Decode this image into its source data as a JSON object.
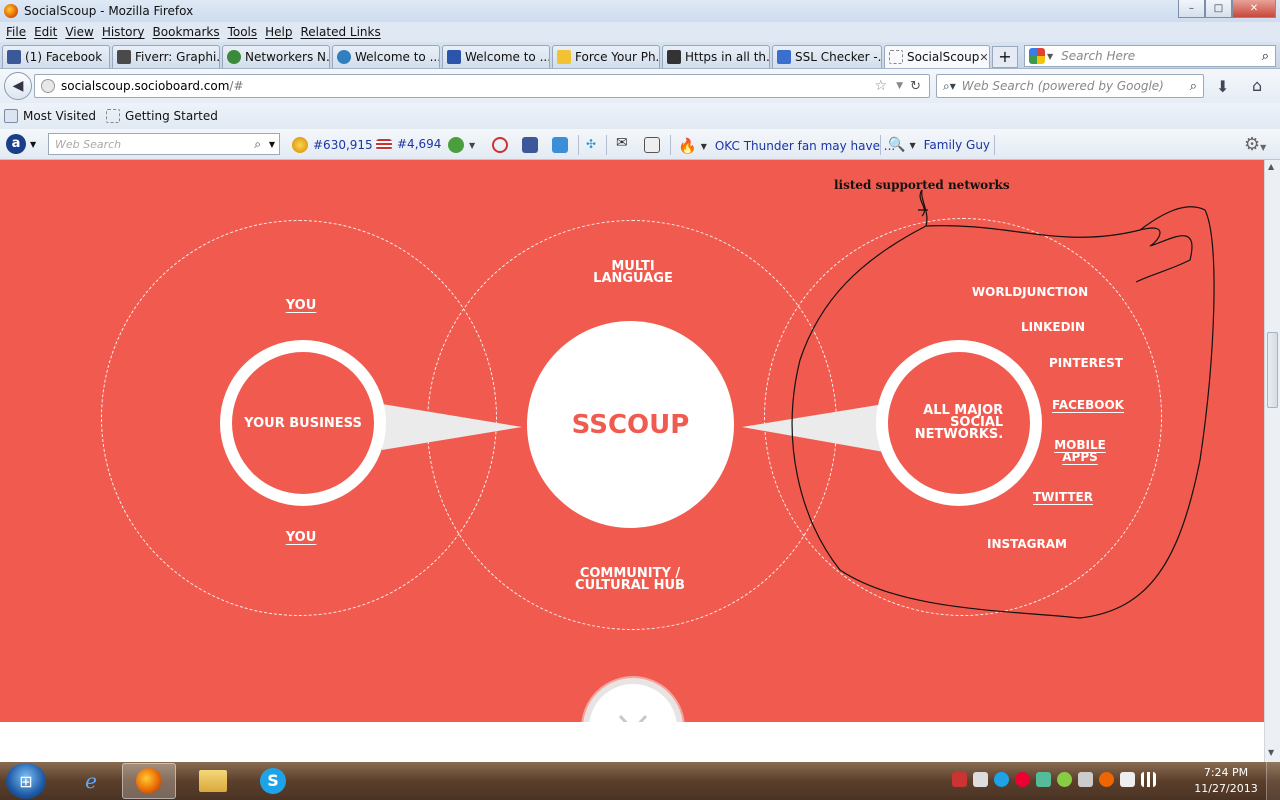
{
  "window": {
    "title": "SocialScoup - Mozilla Firefox",
    "minimize": "–",
    "maximize": "□",
    "close": "✕"
  },
  "menu": [
    "File",
    "Edit",
    "View",
    "History",
    "Bookmarks",
    "Tools",
    "Help",
    "Related Links"
  ],
  "tabs": [
    {
      "label": "(1) Facebook",
      "icon": "facebook-icon"
    },
    {
      "label": "Fiverr: Graphi...",
      "icon": "fiverr-icon"
    },
    {
      "label": "Networkers N...",
      "icon": "networkers-icon"
    },
    {
      "label": "Welcome to ...",
      "icon": "globe-icon"
    },
    {
      "label": "Welcome to ...",
      "icon": "worldjunction-icon"
    },
    {
      "label": "Force Your Ph...",
      "icon": "star-icon"
    },
    {
      "label": "Https in all th...",
      "icon": "pf-icon"
    },
    {
      "label": "SSL Checker -...",
      "icon": "ssl-icon"
    },
    {
      "label": "SocialScoup",
      "icon": "blank-page-icon",
      "active": true
    }
  ],
  "tabsearch": {
    "placeholder": "Search Here"
  },
  "url": {
    "host": "socialscoup.socioboard.com",
    "path": "/#"
  },
  "websearch": {
    "placeholder": "Web Search (powered by Google)"
  },
  "bookmarks": [
    "Most Visited",
    "Getting Started"
  ],
  "asktoolbar": {
    "search_placeholder": "Web Search",
    "rank1": "#630,915",
    "rank2": "#4,694",
    "news": "OKC Thunder fan may have ...",
    "show": "Family Guy"
  },
  "page": {
    "annotation": "listed supported networks",
    "left": {
      "top_label": "YOU",
      "ring_label": "YOUR BUSINESS",
      "bottom_label": "YOU"
    },
    "middle": {
      "top_label": "MULTI\nLANGUAGE",
      "center_label": "SSCOUP",
      "bottom_label": "COMMUNITY /\nCULTURAL HUB"
    },
    "right": {
      "ring_label": "ALL MAJOR\nSOCIAL\nNETWORKS.",
      "networks": [
        "WORLDJUNCTION",
        "LINKEDIN",
        "PINTEREST",
        "FACEBOOK",
        "MOBILE\nAPPS",
        "TWITTER",
        "INSTAGRAM"
      ]
    },
    "scroll_down_icon": "chevron-down-icon"
  },
  "colors": {
    "page_background": "#f15b4f",
    "accent_text": "#f15b4f",
    "white": "#ffffff"
  },
  "taskbar": {
    "time": "7:24 PM",
    "date": "11/27/2013"
  }
}
